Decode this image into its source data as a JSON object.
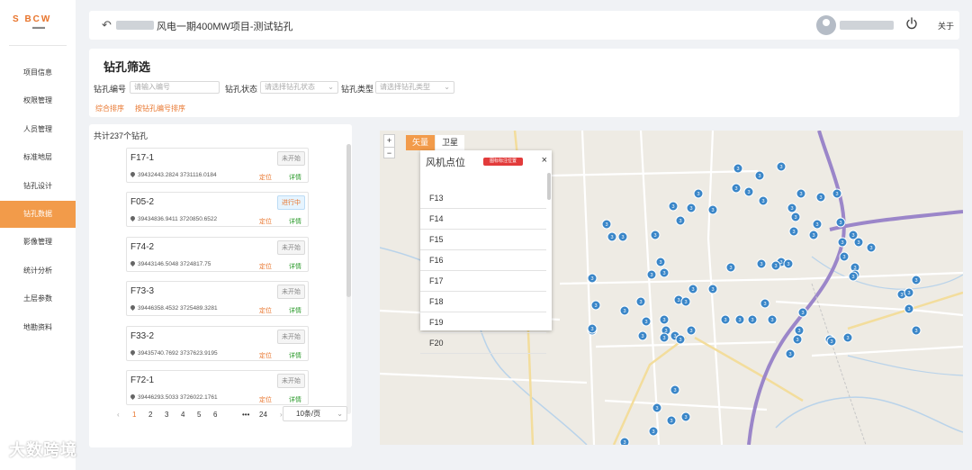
{
  "header": {
    "back_icon": "back-arrow-icon",
    "title": "风电一期400MW项目-测试钻孔",
    "about": "关于",
    "power_icon": "power-icon",
    "avatar_icon": "avatar-icon"
  },
  "sidebar": {
    "logo_text": "S    BCW",
    "items": [
      {
        "label": "项目信息",
        "active": false
      },
      {
        "label": "权限管理",
        "active": false
      },
      {
        "label": "人员管理",
        "active": false
      },
      {
        "label": "标准地层",
        "active": false
      },
      {
        "label": "钻孔设计",
        "active": false
      },
      {
        "label": "钻孔数据",
        "active": true
      },
      {
        "label": "影像管理",
        "active": false
      },
      {
        "label": "统计分析",
        "active": false
      },
      {
        "label": "土层参数",
        "active": false
      },
      {
        "label": "地勘资料",
        "active": false
      }
    ]
  },
  "filter": {
    "title": "钻孔筛选",
    "code_label": "钻孔编号",
    "code_placeholder": "请输入编号",
    "status_label": "钻孔状态",
    "status_placeholder": "请选择钻孔状态",
    "type_label": "钻孔类型",
    "type_placeholder": "请选择钻孔类型",
    "sort_all": "综合排序",
    "sort_code": "按钻孔编号排序"
  },
  "list": {
    "total": "共计237个钻孔",
    "locate": "定位",
    "detail": "详情",
    "items": [
      {
        "name": "F17-1",
        "status": "未开始",
        "coord": "39432443.2824 3731116.0184"
      },
      {
        "name": "F05-2",
        "status": "进行中",
        "coord": "39434836.9411 3720850.6522"
      },
      {
        "name": "F74-2",
        "status": "未开始",
        "coord": "39443146.5048 3724817.75"
      },
      {
        "name": "F73-3",
        "status": "未开始",
        "coord": "39446358.4532 3725489.3281"
      },
      {
        "name": "F33-2",
        "status": "未开始",
        "coord": "39435740.7692 3737623.9195"
      },
      {
        "name": "F72-1",
        "status": "未开始",
        "coord": "39446293.5033 3726022.1761"
      }
    ]
  },
  "pager": {
    "prev": "‹",
    "pages": [
      "1",
      "2",
      "3",
      "4",
      "5",
      "6"
    ],
    "ellipsis": "•••",
    "last": "24",
    "next": "›",
    "size": "10条/页",
    "current": "1"
  },
  "map": {
    "zoom_in": "+",
    "zoom_out": "−",
    "type_vector": "矢量",
    "type_satellite": "卫星",
    "popup_title": "风机点位",
    "popup_tag": "图标标注位置",
    "popup_close": "×",
    "turbines": [
      "F13",
      "F14",
      "F15",
      "F16",
      "F17",
      "F18",
      "F19",
      "F20"
    ],
    "cluster_label": "3"
  },
  "colors": {
    "accent": "#f29b4a",
    "orange_text": "#e8742b",
    "marker": "#3a86c8",
    "highway": "#9b86c9"
  }
}
